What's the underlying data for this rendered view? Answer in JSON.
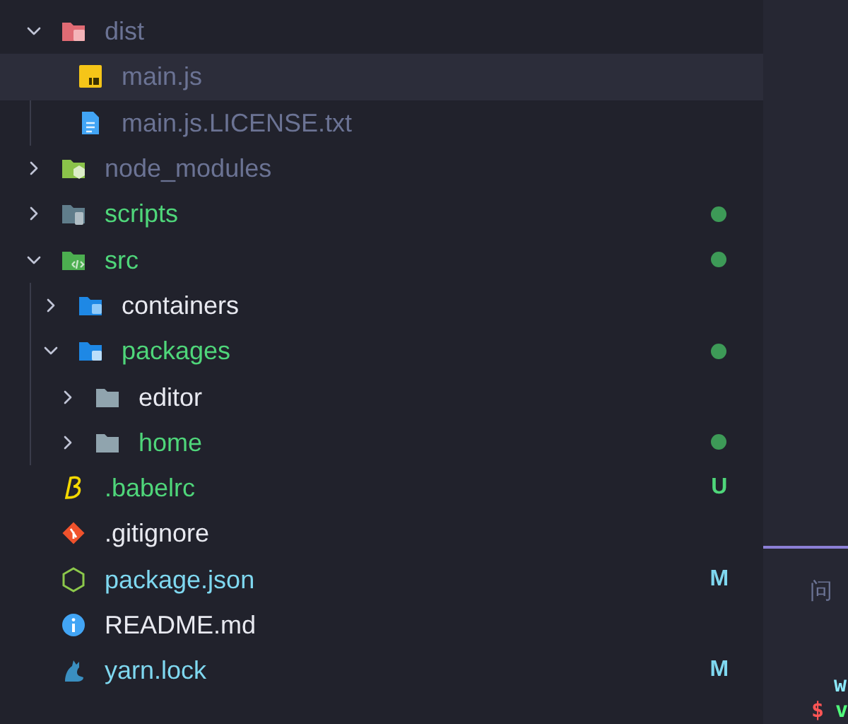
{
  "explorer": {
    "items": [
      {
        "name": "dist",
        "kind": "folder-dist",
        "color": "#6b7394",
        "expanded": true,
        "selected": false,
        "children": [
          {
            "name": "main.js",
            "kind": "js",
            "color": "#6b7394",
            "selected": true
          },
          {
            "name": "main.js.LICENSE.txt",
            "kind": "text",
            "color": "#6b7394",
            "selected": false
          }
        ]
      },
      {
        "name": "node_modules",
        "kind": "folder-node",
        "color": "#6b7394",
        "expanded": false,
        "selected": false
      },
      {
        "name": "scripts",
        "kind": "folder-scripts",
        "color": "#4fd67a",
        "expanded": false,
        "selected": false,
        "dot": true
      },
      {
        "name": "src",
        "kind": "folder-src",
        "color": "#4fd67a",
        "expanded": true,
        "selected": false,
        "dot": true,
        "children": [
          {
            "name": "containers",
            "kind": "folder-containers",
            "color": "#e8e9f0",
            "expanded": false,
            "selected": false
          },
          {
            "name": "packages",
            "kind": "folder-packages",
            "color": "#4fd67a",
            "expanded": true,
            "selected": false,
            "dot": true,
            "children": [
              {
                "name": "editor",
                "kind": "folder",
                "color": "#e8e9f0",
                "expanded": false,
                "selected": false
              },
              {
                "name": "home",
                "kind": "folder",
                "color": "#4fd67a",
                "expanded": false,
                "selected": false,
                "dot": true
              }
            ]
          }
        ]
      },
      {
        "name": ".babelrc",
        "kind": "babel",
        "color": "#4fd67a",
        "selected": false,
        "badge": "U"
      },
      {
        "name": ".gitignore",
        "kind": "git",
        "color": "#e8e9f0",
        "selected": false
      },
      {
        "name": "package.json",
        "kind": "nodejs",
        "color": "#7fd8f0",
        "selected": false,
        "badge": "M"
      },
      {
        "name": "README.md",
        "kind": "info",
        "color": "#e8e9f0",
        "selected": false
      },
      {
        "name": "yarn.lock",
        "kind": "yarn",
        "color": "#7fd8f0",
        "selected": false,
        "badge": "M"
      }
    ]
  },
  "panel": {
    "tab": "问",
    "terminal": [
      {
        "kind": "output",
        "text": "w"
      },
      {
        "kind": "command",
        "prompt": "$",
        "text": "v"
      }
    ]
  }
}
